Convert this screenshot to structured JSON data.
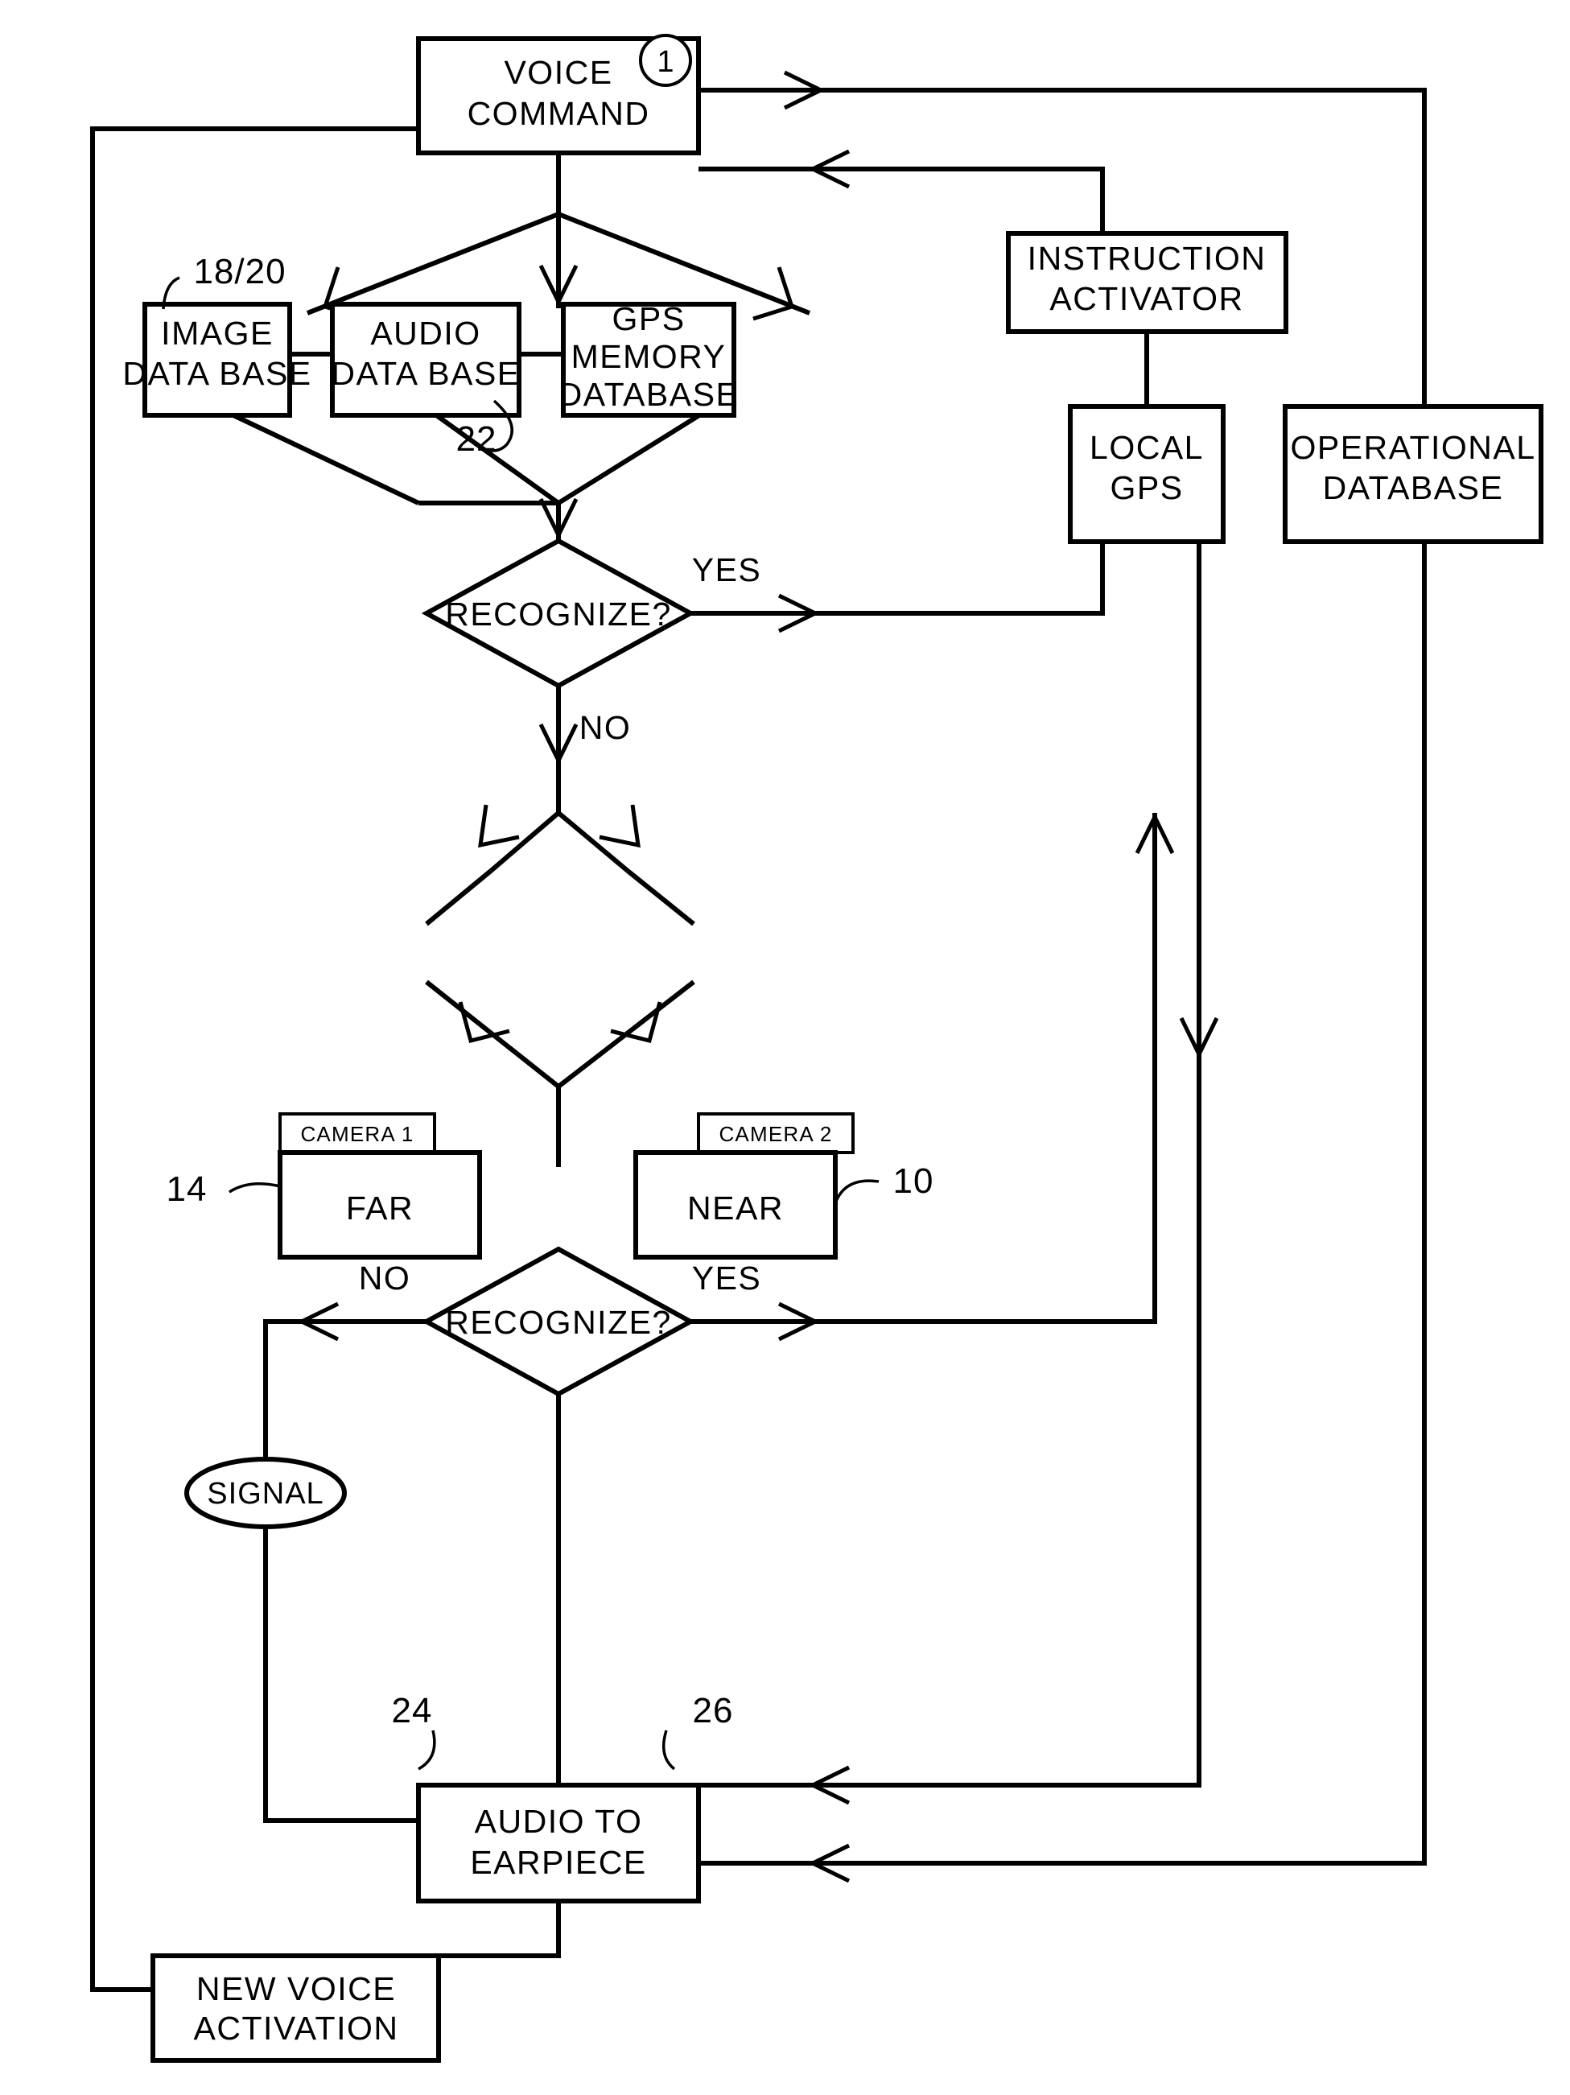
{
  "diagram": {
    "title": "Voice command recognition flowchart",
    "style": {
      "line_color": "#000000",
      "fill_color": "#ffffff",
      "background": "#ffffff"
    },
    "nodes": {
      "voice_command": {
        "label_line1": "VOICE",
        "label_line2": "COMMAND",
        "marker": "1"
      },
      "instruction_activator": {
        "label_line1": "INSTRUCTION",
        "label_line2": "ACTIVATOR"
      },
      "image_db": {
        "label_line1": "IMAGE",
        "label_line2": "DATA  BASE"
      },
      "audio_db": {
        "label_line1": "AUDIO",
        "label_line2": "DATA  BASE"
      },
      "gps_memory_db": {
        "label_line1": "GPS",
        "label_line2": "MEMORY",
        "label_line3": "DATABASE"
      },
      "local_gps": {
        "label_line1": "LOCAL",
        "label_line2": "GPS"
      },
      "operational_db": {
        "label_line1": "OPERATIONAL",
        "label_line2": "DATABASE"
      },
      "recognize_1": {
        "label": "RECOGNIZE?"
      },
      "recognize_2": {
        "label": "RECOGNIZE?"
      },
      "camera1": {
        "tab": "CAMERA  1",
        "label": "FAR"
      },
      "camera2": {
        "tab": "CAMERA  2",
        "label": "NEAR"
      },
      "signal": {
        "label": "SIGNAL"
      },
      "audio_to_earpiece": {
        "label_line1": "AUDIO  TO",
        "label_line2": "EARPIECE"
      },
      "new_voice_activation": {
        "label_line1": "NEW  VOICE",
        "label_line2": "ACTIVATION"
      }
    },
    "branch_labels": {
      "recognize_1_yes": "YES",
      "recognize_1_no": "NO",
      "recognize_2_yes": "YES",
      "recognize_2_no": "NO"
    },
    "reference_numerals": {
      "databases_group": "18/20",
      "audio_db": "22",
      "camera1_far": "14",
      "camera2_near": "10",
      "earpiece_left": "24",
      "earpiece_right": "26",
      "voice_command_circle": "1"
    }
  }
}
